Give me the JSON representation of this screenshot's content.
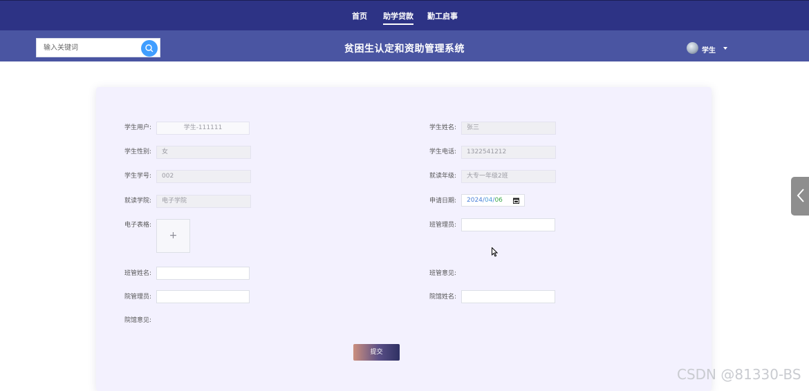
{
  "nav": {
    "items": [
      {
        "label": "首页"
      },
      {
        "label": "助学贷款"
      },
      {
        "label": "勤工启事"
      }
    ]
  },
  "search": {
    "placeholder": "输入关键词"
  },
  "header": {
    "title": "贫困生认定和资助管理系统"
  },
  "user": {
    "name": "学生"
  },
  "form": {
    "student_user": {
      "label": "学生用户:",
      "value": "学生-111111"
    },
    "student_name": {
      "label": "学生姓名:",
      "value": "张三"
    },
    "gender": {
      "label": "学生性别:",
      "value": "女"
    },
    "phone": {
      "label": "学生电话:",
      "value": "1322541212"
    },
    "student_no": {
      "label": "学生学号:",
      "value": "002"
    },
    "grade": {
      "label": "就读年级:",
      "value": "大专一年级2班"
    },
    "college": {
      "label": "就读学院:",
      "value": "电子学院"
    },
    "apply_date": {
      "label": "申请日期:",
      "year": "2024",
      "month": "04",
      "day": "06"
    },
    "e_form": {
      "label": "电子表格:"
    },
    "class_admin": {
      "label": "班管理员:",
      "value": ""
    },
    "class_admin_name": {
      "label": "班管姓名:",
      "value": ""
    },
    "class_opinion": {
      "label": "班管意见:"
    },
    "college_admin": {
      "label": "院管理员:",
      "value": ""
    },
    "college_admin_name": {
      "label": "院馆姓名:",
      "value": ""
    },
    "college_opinion": {
      "label": "院馆意见:"
    },
    "submit_label": "提交"
  },
  "watermark": "CSDN @81330-BS",
  "colors": {
    "topbar": "#2d3385",
    "subbar": "#4a55a2",
    "card": "#f3f1fe",
    "search_button": "#409eff",
    "side_tab": "#8e8e8e"
  }
}
